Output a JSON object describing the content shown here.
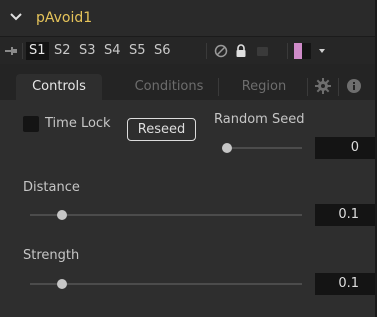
{
  "node": {
    "name": "pAvoid1",
    "expanded": true
  },
  "toolbar": {
    "slots": [
      "S1",
      "S2",
      "S3",
      "S4",
      "S5",
      "S6"
    ],
    "active_slot": "S1",
    "icons": [
      "pin-icon",
      "disable-icon",
      "lock-icon",
      "passthrough-icon"
    ],
    "swatch_colors": [
      "#cf8bc9",
      "#151515"
    ]
  },
  "tabs": [
    {
      "label": "Controls",
      "active": true
    },
    {
      "label": "Conditions",
      "active": false
    },
    {
      "label": "Region",
      "active": false
    },
    {
      "icon": "gear-icon"
    },
    {
      "icon": "info-icon"
    }
  ],
  "controls": {
    "time_lock": {
      "label": "Time Lock",
      "checked": false
    },
    "reseed": {
      "label": "Reseed"
    },
    "random_seed": {
      "label": "Random Seed",
      "value": "0"
    },
    "distance": {
      "label": "Distance",
      "value": "0.1"
    },
    "strength": {
      "label": "Strength",
      "value": "0.1"
    }
  },
  "colors": {
    "title": "#e6c45a",
    "panel_bg": "#2e2e2e",
    "field_bg": "#141414"
  }
}
